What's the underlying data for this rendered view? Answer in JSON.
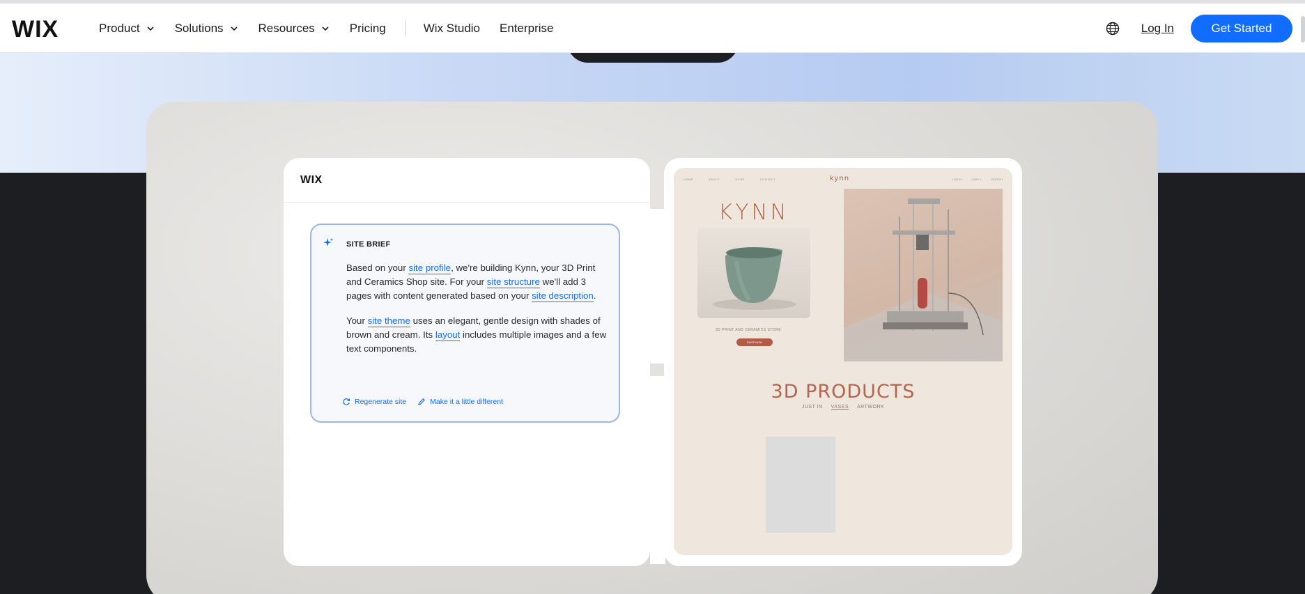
{
  "brand": "WIX",
  "nav": {
    "items": [
      {
        "label": "Product",
        "dropdown": true
      },
      {
        "label": "Solutions",
        "dropdown": true
      },
      {
        "label": "Resources",
        "dropdown": true
      },
      {
        "label": "Pricing",
        "dropdown": false
      }
    ],
    "secondary": [
      "Wix Studio",
      "Enterprise"
    ],
    "login": "Log In",
    "cta": "Get Started"
  },
  "editor": {
    "logo": "WIX",
    "brief": {
      "title": "SITE BRIEF",
      "p1_a": "Based on your ",
      "p1_link1": "site profile",
      "p1_b": ", we're building Kynn, your 3D Print and Ceramics Shop site. For your ",
      "p1_link2": "site structure",
      "p1_c": " we'll add 3 pages with content generated based on your ",
      "p1_link3": "site description",
      "p1_d": ".",
      "p2_a": "Your ",
      "p2_link1": "site theme",
      "p2_b": " uses an elegant, gentle design with shades of brown and cream. Its ",
      "p2_link2": "layout",
      "p2_c": " includes multiple images and a few text components."
    },
    "actions": [
      "Regenerate site",
      "Make it a little different"
    ]
  },
  "preview": {
    "nav_left": [
      "HOME",
      "ABOUT",
      "SHOP",
      "CONTACT"
    ],
    "brand": "kynn",
    "nav_right": [
      "LOG IN",
      "CART 0",
      "SEARCH"
    ],
    "hero_title": "KYNN",
    "caption": "3D PRINT AND CERAMICS STORE",
    "button": "SHOP NOW",
    "section_title": "3D PRODUCTS",
    "tabs": [
      "JUST IN",
      "VASES",
      "ARTWORK"
    ]
  },
  "colors": {
    "accent": "#116dff",
    "brand_clay": "#b3664f",
    "dark_bg": "#1c1e21"
  }
}
